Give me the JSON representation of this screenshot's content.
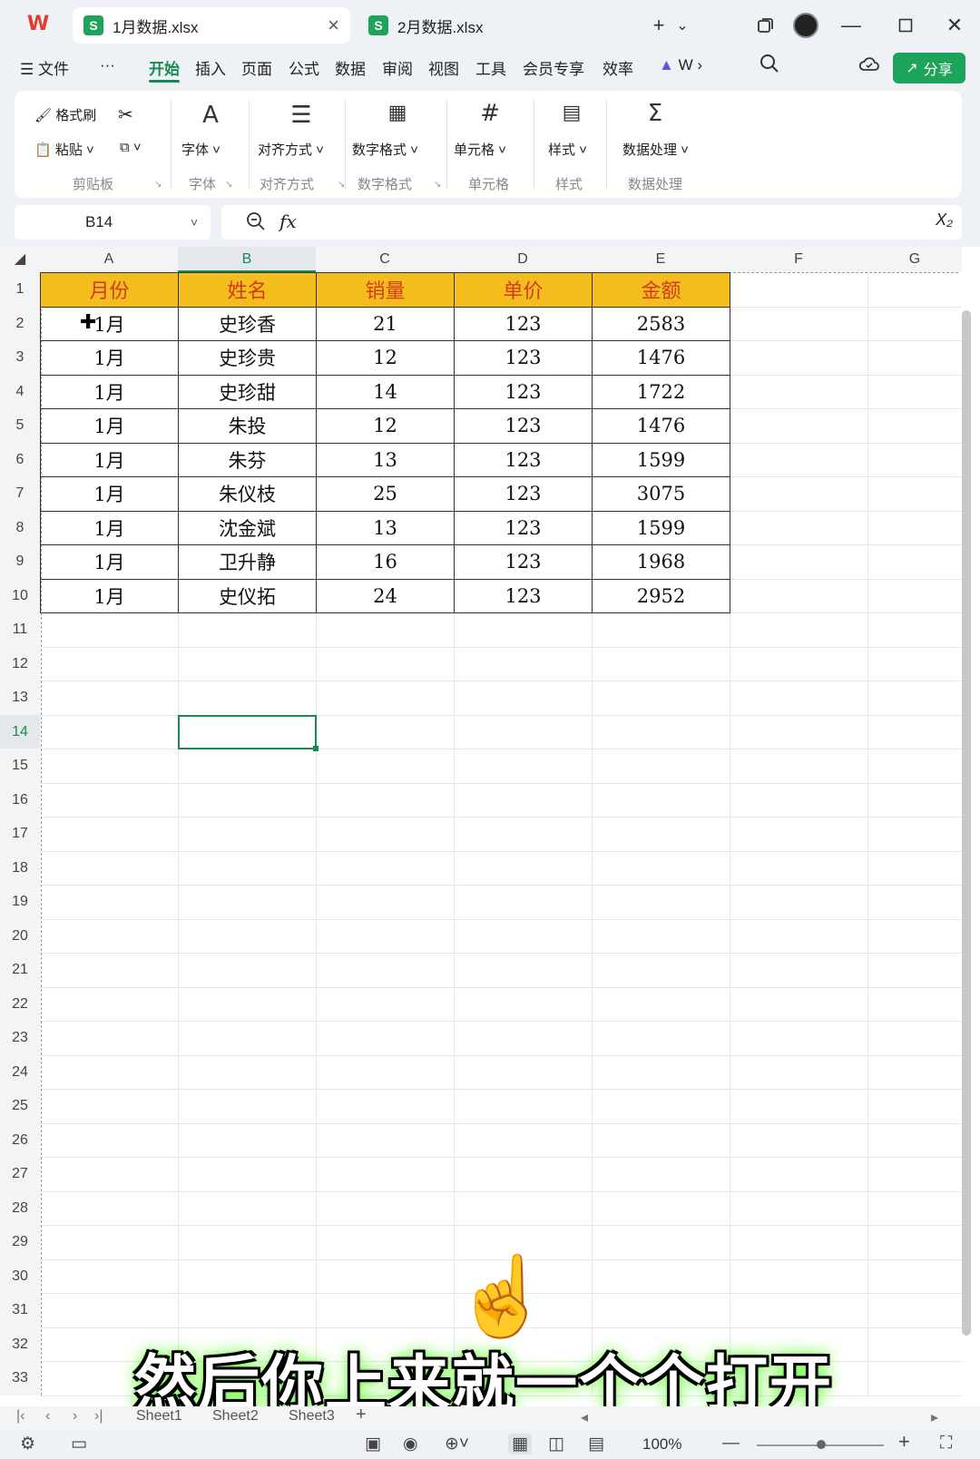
{
  "titlebar": {
    "tabs": [
      {
        "icon_letter": "S",
        "label": "1月数据.xlsx",
        "active": true
      },
      {
        "icon_letter": "S",
        "label": "2月数据.xlsx",
        "active": false
      }
    ],
    "new_tab": "+",
    "new_tab_chevron": "⌄",
    "icons": [
      "wps-logo",
      "restore-icon",
      "avatar",
      "minimize-icon",
      "maximize-icon",
      "close-icon"
    ]
  },
  "menubar": {
    "file": "文件",
    "more": "···",
    "items": [
      "开始",
      "插入",
      "页面",
      "公式",
      "数据",
      "审阅",
      "视图",
      "工具",
      "会员专享",
      "效率",
      "W"
    ],
    "active": "开始",
    "share": "分享"
  },
  "ribbon": {
    "format_painter": "格式刷",
    "paste": "粘贴",
    "clipboard_group": "剪贴板",
    "font_label": "字体",
    "font_group": "字体",
    "align_label": "对齐方式",
    "align_group": "对齐方式",
    "number_label": "数字格式",
    "number_group": "数字格式",
    "cell_label": "单元格",
    "cell_group": "单元格",
    "style_label": "样式",
    "style_group": "样式",
    "data_label": "数据处理",
    "data_group": "数据处理"
  },
  "formula_bar": {
    "name_box": "B14",
    "fx": "fx",
    "formula": ""
  },
  "columns": [
    "A",
    "B",
    "C",
    "D",
    "E",
    "F",
    "G"
  ],
  "selected_column": "B",
  "selected_row": 14,
  "rows": [
    "1",
    "2",
    "3",
    "4",
    "5",
    "6",
    "7",
    "8",
    "9",
    "10",
    "11",
    "12",
    "13",
    "14",
    "15",
    "16",
    "17",
    "18",
    "19",
    "20",
    "21",
    "22",
    "23",
    "24",
    "25",
    "26",
    "27",
    "28",
    "29",
    "30",
    "31",
    "32",
    "33"
  ],
  "table": {
    "headers": [
      "月份",
      "姓名",
      "销量",
      "单价",
      "金额"
    ],
    "rows": [
      [
        "1月",
        "史珍香",
        "21",
        "123",
        "2583"
      ],
      [
        "1月",
        "史珍贵",
        "12",
        "123",
        "1476"
      ],
      [
        "1月",
        "史珍甜",
        "14",
        "123",
        "1722"
      ],
      [
        "1月",
        "朱投",
        "12",
        "123",
        "1476"
      ],
      [
        "1月",
        "朱芬",
        "13",
        "123",
        "1599"
      ],
      [
        "1月",
        "朱仪枝",
        "25",
        "123",
        "3075"
      ],
      [
        "1月",
        "沈金斌",
        "13",
        "123",
        "1599"
      ],
      [
        "1月",
        "卫升静",
        "16",
        "123",
        "1968"
      ],
      [
        "1月",
        "史仪拓",
        "24",
        "123",
        "2952"
      ]
    ],
    "header_bg": "#f2bd1d",
    "header_color": "#d43b1d"
  },
  "caption": "然后你上来就一个个打开",
  "sheets": [
    "Sheet1",
    "Sheet2",
    "Sheet3"
  ],
  "add_sheet": "+",
  "status": {
    "zoom": "100%",
    "zoom_out": "—",
    "zoom_in": "+"
  },
  "colors": {
    "accent": "#168a4f",
    "share_button": "#1ea35a",
    "wps_red": "#e23d2f"
  }
}
